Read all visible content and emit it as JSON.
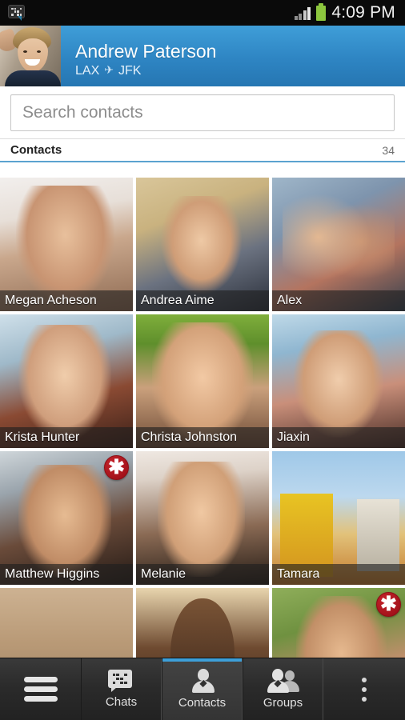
{
  "statusbar": {
    "notification_icon": "bbm-message-icon",
    "signal_icon": "signal-bars-icon",
    "battery_icon": "battery-icon",
    "time": "4:09 PM"
  },
  "profile": {
    "avatar_icon": "profile-avatar",
    "name": "Andrew Paterson",
    "status_origin": "LAX",
    "status_icon": "airplane-icon",
    "status_glyph": "✈",
    "status_destination": "JFK",
    "accent_color": "#2e85c3"
  },
  "search": {
    "placeholder": "Search contacts",
    "value": ""
  },
  "section": {
    "title": "Contacts",
    "count": "34",
    "underline_color": "#5ba3d0"
  },
  "grid": {
    "badge_glyph": "✱",
    "badge_color": "#a3121a",
    "rows": [
      [
        {
          "name": "Megan Acheson",
          "photo": "p-megan",
          "new": false
        },
        {
          "name": "Andrea Aime",
          "photo": "p-andrea",
          "new": false
        },
        {
          "name": "Alex",
          "photo": "p-alex",
          "new": false
        }
      ],
      [
        {
          "name": "Krista Hunter",
          "photo": "p-krista",
          "new": false
        },
        {
          "name": "Christa Johnston",
          "photo": "p-christa",
          "new": false
        },
        {
          "name": "Jiaxin",
          "photo": "p-jiaxin",
          "new": false
        }
      ],
      [
        {
          "name": "Matthew Higgins",
          "photo": "p-matthew",
          "new": true
        },
        {
          "name": "Melanie",
          "photo": "p-melanie",
          "new": false
        },
        {
          "name": "Tamara",
          "photo": "p-tamara",
          "new": false
        }
      ],
      [
        {
          "name": "",
          "photo": "p-partial1",
          "new": false
        },
        {
          "name": "",
          "photo": "p-partial2",
          "new": false
        },
        {
          "name": "",
          "photo": "p-partial3",
          "new": true
        }
      ]
    ]
  },
  "navbar": {
    "menu_icon": "hamburger-menu-icon",
    "tabs": [
      {
        "label": "Chats",
        "icon": "bbm-chats-icon",
        "active": false
      },
      {
        "label": "Contacts",
        "icon": "person-icon",
        "active": true
      },
      {
        "label": "Groups",
        "icon": "group-people-icon",
        "active": false
      }
    ],
    "overflow_icon": "overflow-menu-icon",
    "active_indicator_color": "#3d9fd9"
  }
}
